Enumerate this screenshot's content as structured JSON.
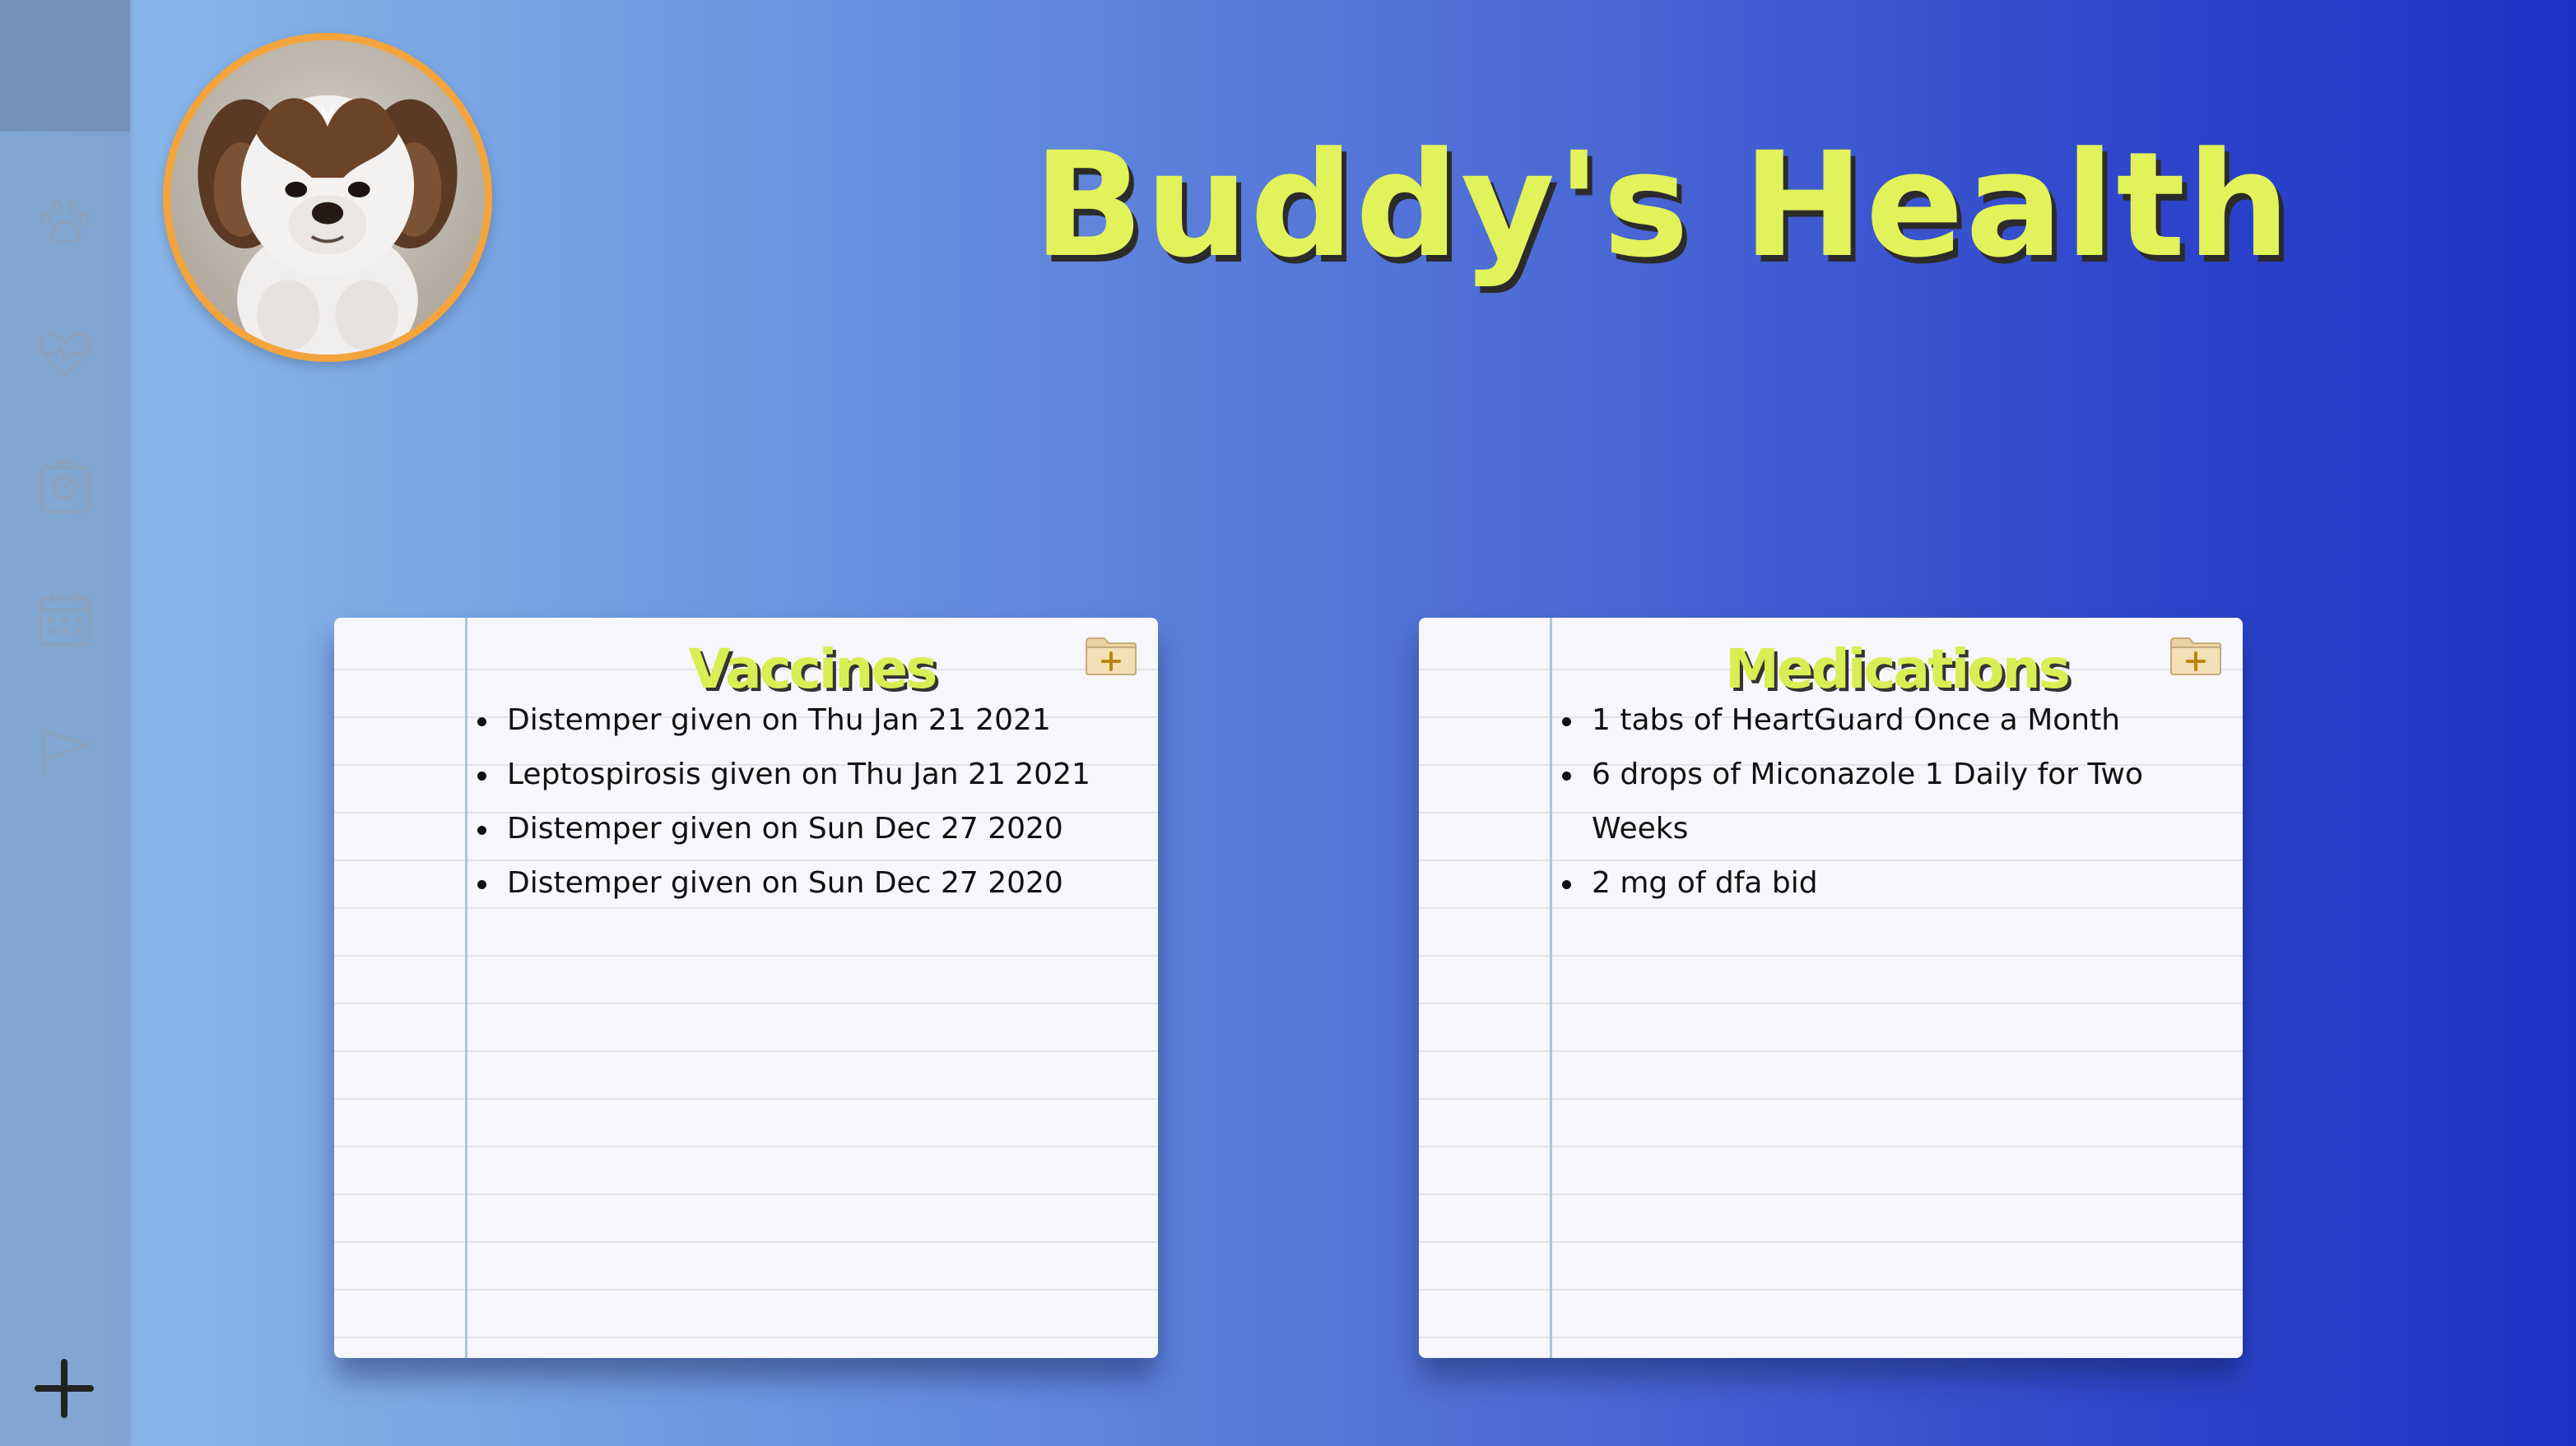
{
  "page": {
    "title": "Buddy's Health"
  },
  "sidebar": {
    "items": [
      {
        "icon": "paw-icon"
      },
      {
        "icon": "heartbeat-icon"
      },
      {
        "icon": "clipboard-gauge-icon"
      },
      {
        "icon": "calendar-icon"
      },
      {
        "icon": "flag-icon"
      }
    ],
    "add_icon": "plus-icon"
  },
  "avatar": {
    "icon": "dog-photo"
  },
  "vaccines": {
    "title": "Vaccines",
    "add_icon": "folder-add-icon",
    "items": [
      "Distemper given on Thu Jan 21 2021",
      "Leptospirosis given on Thu Jan 21 2021",
      "Distemper given on Sun Dec 27 2020",
      "Distemper given on Sun Dec 27 2020"
    ]
  },
  "medications": {
    "title": "Medications",
    "add_icon": "folder-add-icon",
    "items": [
      "1 tabs of HeartGuard Once a Month",
      "6 drops of Miconazole 1 Daily for Two Weeks",
      "2 mg of dfa bid"
    ]
  },
  "colors": {
    "title": "#e2f25a",
    "avatar_border": "#f4a43a",
    "gradient_left": "#8fbdea",
    "gradient_right": "#1c33c4"
  }
}
